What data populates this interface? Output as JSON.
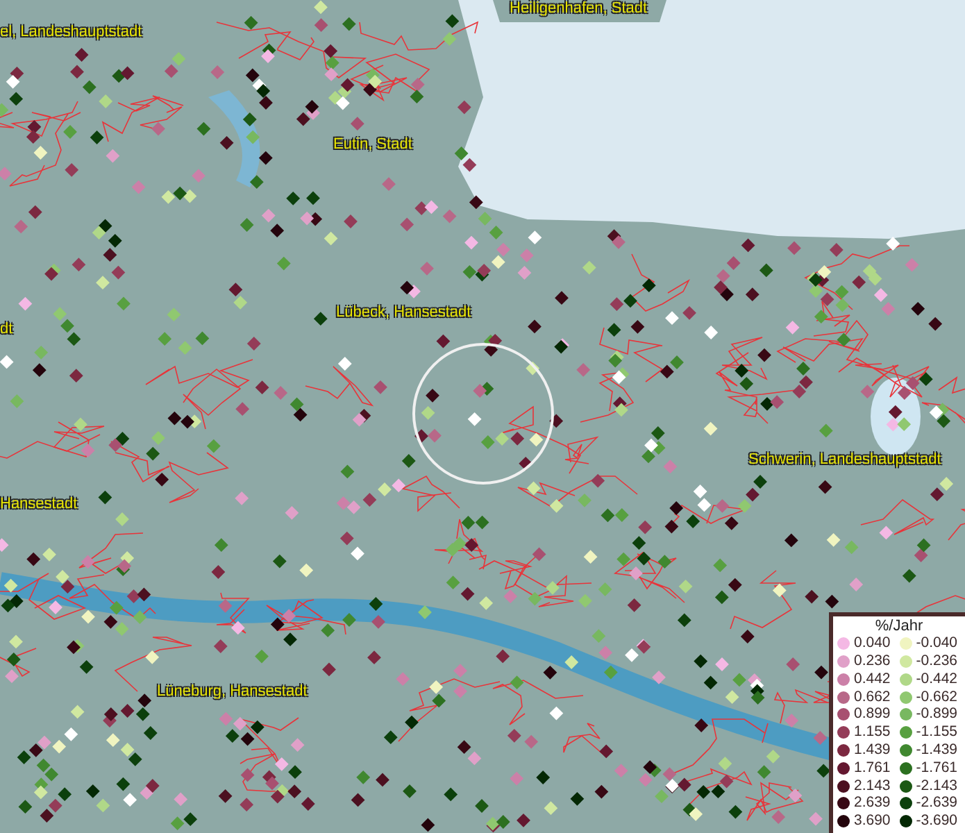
{
  "places": [
    {
      "name": "Heiligenhafen, Stadt"
    },
    {
      "name": "el, Landeshauptstadt"
    },
    {
      "name": "Eutin, Stadt"
    },
    {
      "name": "dt"
    },
    {
      "name": "Lübeck, Hansestadt"
    },
    {
      "name": "Schwerin, Landeshauptstadt"
    },
    {
      "name": "Hansestadt"
    },
    {
      "name": "Lüneburg, Hansestadt"
    }
  ],
  "legend": {
    "title": "%/Jahr",
    "rows": [
      {
        "left": {
          "label": "0.040",
          "color": "#f4b8e4"
        },
        "right": {
          "label": "-0.040",
          "color": "#f0f4c0"
        }
      },
      {
        "left": {
          "label": "0.236",
          "color": "#e0a0c8"
        },
        "right": {
          "label": "-0.236",
          "color": "#d0e8a0"
        }
      },
      {
        "left": {
          "label": "0.442",
          "color": "#cc80a8"
        },
        "right": {
          "label": "-0.442",
          "color": "#b0d888"
        }
      },
      {
        "left": {
          "label": "0.662",
          "color": "#b86888"
        },
        "right": {
          "label": "-0.662",
          "color": "#90c870"
        }
      },
      {
        "left": {
          "label": "0.899",
          "color": "#a85070"
        },
        "right": {
          "label": "-0.899",
          "color": "#78b860"
        }
      },
      {
        "left": {
          "label": "1.155",
          "color": "#943c58"
        },
        "right": {
          "label": "-1.155",
          "color": "#58a040"
        }
      },
      {
        "left": {
          "label": "1.439",
          "color": "#7c2840"
        },
        "right": {
          "label": "-1.439",
          "color": "#408830"
        }
      },
      {
        "left": {
          "label": "1.761",
          "color": "#641830"
        },
        "right": {
          "label": "-1.761",
          "color": "#2c7020"
        }
      },
      {
        "left": {
          "label": "2.143",
          "color": "#4c1020"
        },
        "right": {
          "label": "-2.143",
          "color": "#1c5814"
        }
      },
      {
        "left": {
          "label": "2.639",
          "color": "#380814"
        },
        "right": {
          "label": "-2.639",
          "color": "#0c400c"
        }
      },
      {
        "left": {
          "label": "3.690",
          "color": "#24040c"
        },
        "right": {
          "label": "-3.690",
          "color": "#042804"
        }
      }
    ]
  }
}
